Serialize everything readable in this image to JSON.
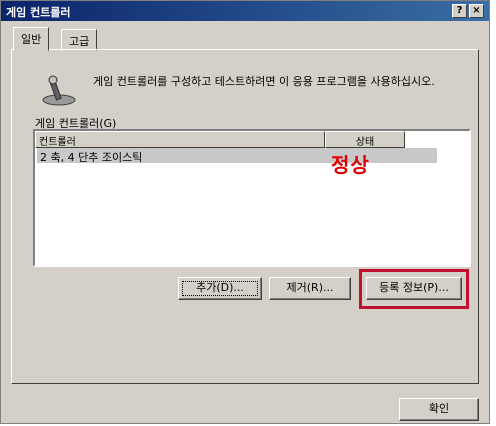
{
  "window": {
    "title": "게임 컨트롤러",
    "help_button": "?",
    "close_button": "×"
  },
  "tabs": [
    {
      "label": "일반"
    },
    {
      "label": "고급"
    }
  ],
  "description": "게임 컨트롤러를 구성하고 테스트하려면 이 응용 프로그램을 사용하십시오.",
  "controllers_section": {
    "label": "게임 컨트롤러(G)",
    "columns": [
      "컨트롤러",
      "상태"
    ],
    "rows": [
      {
        "controller": "2 축, 4 단추 조이스틱",
        "status": "정상"
      }
    ]
  },
  "buttons": {
    "add": "추가(D)...",
    "remove": "제거(R)...",
    "properties": "등록 정보(P)...",
    "ok": "확인"
  },
  "colors": {
    "highlight_box": "#c01030",
    "status_text": "#e00000",
    "titlebar": "#0a246a"
  },
  "icons": {
    "controller": "joystick-icon"
  }
}
